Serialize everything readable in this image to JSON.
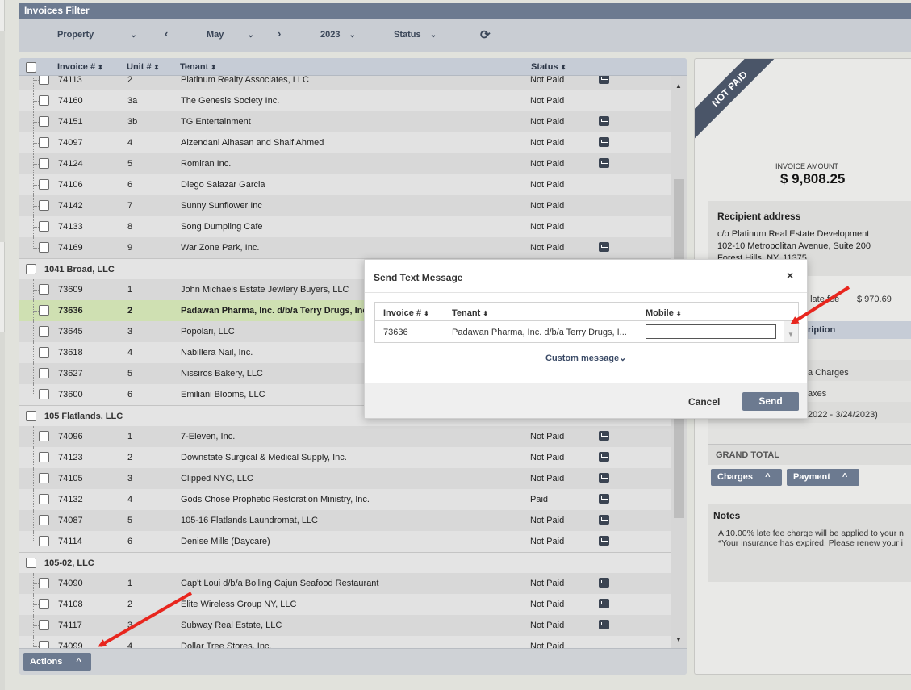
{
  "filter": {
    "title": "Invoices Filter",
    "property_label": "Property",
    "month": "May",
    "year": "2023",
    "status_label": "Status",
    "chev_down": "⌄",
    "prev_glyph": "‹",
    "next_glyph": "›",
    "refresh_glyph": "⟳"
  },
  "list": {
    "columns": {
      "invoice": "Invoice #",
      "unit": "Unit #",
      "tenant": "Tenant",
      "status": "Status"
    },
    "sort_glyph": "⬍",
    "rows": [
      {
        "type": "row",
        "invoice": "74113",
        "unit": "2",
        "tenant": "Platinum Realty Associates, LLC",
        "status": "Not Paid",
        "mail": true,
        "clip": true
      },
      {
        "type": "row",
        "invoice": "74160",
        "unit": "3a",
        "tenant": "The Genesis Society Inc.",
        "status": "Not Paid",
        "mail": false
      },
      {
        "type": "row",
        "invoice": "74151",
        "unit": "3b",
        "tenant": "TG Entertainment",
        "status": "Not Paid",
        "mail": true
      },
      {
        "type": "row",
        "invoice": "74097",
        "unit": "4",
        "tenant": "Alzendani Alhasan and Shaif Ahmed",
        "status": "Not Paid",
        "mail": true
      },
      {
        "type": "row",
        "invoice": "74124",
        "unit": "5",
        "tenant": "Romiran Inc.",
        "status": "Not Paid",
        "mail": true
      },
      {
        "type": "row",
        "invoice": "74106",
        "unit": "6",
        "tenant": "Diego Salazar Garcia",
        "status": "Not Paid",
        "mail": false
      },
      {
        "type": "row",
        "invoice": "74142",
        "unit": "7",
        "tenant": "Sunny Sunflower Inc",
        "status": "Not Paid",
        "mail": false
      },
      {
        "type": "row",
        "invoice": "74133",
        "unit": "8",
        "tenant": "Song Dumpling Cafe",
        "status": "Not Paid",
        "mail": false
      },
      {
        "type": "row",
        "invoice": "74169",
        "unit": "9",
        "tenant": "War Zone Park, Inc.",
        "status": "Not Paid",
        "mail": true,
        "last": true
      },
      {
        "type": "group",
        "name": "1041 Broad, LLC"
      },
      {
        "type": "row",
        "invoice": "73609",
        "unit": "1",
        "tenant": "John Michaels Estate Jewlery Buyers, LLC",
        "status": "",
        "mail": false
      },
      {
        "type": "row",
        "invoice": "73636",
        "unit": "2",
        "tenant": "Padawan Pharma, Inc. d/b/a Terry Drugs, Inc",
        "status": "",
        "mail": false,
        "selected": true
      },
      {
        "type": "row",
        "invoice": "73645",
        "unit": "3",
        "tenant": "Popolari, LLC",
        "status": "",
        "mail": false
      },
      {
        "type": "row",
        "invoice": "73618",
        "unit": "4",
        "tenant": "Nabillera Nail, Inc.",
        "status": "",
        "mail": false
      },
      {
        "type": "row",
        "invoice": "73627",
        "unit": "5",
        "tenant": "Nissiros Bakery, LLC",
        "status": "",
        "mail": false
      },
      {
        "type": "row",
        "invoice": "73600",
        "unit": "6",
        "tenant": "Emiliani Blooms, LLC",
        "status": "",
        "mail": false,
        "last": true
      },
      {
        "type": "group",
        "name": "105 Flatlands, LLC"
      },
      {
        "type": "row",
        "invoice": "74096",
        "unit": "1",
        "tenant": "7-Eleven, Inc.",
        "status": "Not Paid",
        "mail": true
      },
      {
        "type": "row",
        "invoice": "74123",
        "unit": "2",
        "tenant": "Downstate Surgical & Medical Supply, Inc.",
        "status": "Not Paid",
        "mail": true
      },
      {
        "type": "row",
        "invoice": "74105",
        "unit": "3",
        "tenant": "Clipped NYC, LLC",
        "status": "Not Paid",
        "mail": true
      },
      {
        "type": "row",
        "invoice": "74132",
        "unit": "4",
        "tenant": "Gods Chose Prophetic Restoration Ministry, Inc.",
        "status": "Paid",
        "mail": true
      },
      {
        "type": "row",
        "invoice": "74087",
        "unit": "5",
        "tenant": "105-16 Flatlands Laundromat, LLC",
        "status": "Not Paid",
        "mail": true
      },
      {
        "type": "row",
        "invoice": "74114",
        "unit": "6",
        "tenant": "Denise Mills (Daycare)",
        "status": "Not Paid",
        "mail": true,
        "last": true
      },
      {
        "type": "group",
        "name": "105-02, LLC"
      },
      {
        "type": "row",
        "invoice": "74090",
        "unit": "1",
        "tenant": "Cap't Loui d/b/a Boiling Cajun Seafood Restaurant",
        "status": "Not Paid",
        "mail": true
      },
      {
        "type": "row",
        "invoice": "74108",
        "unit": "2",
        "tenant": "Elite Wireless Group NY, LLC",
        "status": "Not Paid",
        "mail": true
      },
      {
        "type": "row",
        "invoice": "74117",
        "unit": "3",
        "tenant": "Subway Real Estate, LLC",
        "status": "Not Paid",
        "mail": true
      },
      {
        "type": "row",
        "invoice": "74099",
        "unit": "4",
        "tenant": "Dollar Tree Stores, Inc.",
        "status": "Not Paid",
        "mail": false
      }
    ],
    "actions_label": "Actions",
    "up_glyph": "^",
    "scroll_up": "▲",
    "scroll_down": "▼"
  },
  "invoice": {
    "ribbon": "NOT PAID",
    "amount_label": "INVOICE AMOUNT",
    "amount": "$ 9,808.25",
    "recipient_title": "Recipient address",
    "address_lines": [
      "c/o Platinum Real Estate Development",
      "102-10 Metropolitan Avenue, Suite 200",
      "Forest Hills, NY, 11375"
    ],
    "late_fee_label": "ply late fee",
    "late_fee_amount": "$ 970.69",
    "description_header": "ription",
    "desc_lines": [
      "a Charges",
      "axes",
      "2022 - 3/24/2023)"
    ],
    "grand_total_label": "GRAND TOTAL",
    "charges_label": "Charges",
    "payment_label": "Payment",
    "notes_title": "Notes",
    "notes_lines": [
      "A 10.00% late fee charge will be applied to your n",
      "*Your insurance has expired. Please renew your i"
    ]
  },
  "modal": {
    "title": "Send Text Message",
    "close_glyph": "×",
    "col_invoice": "Invoice #",
    "col_tenant": "Tenant",
    "col_mobile": "Mobile",
    "invoice": "73636",
    "tenant": "Padawan Pharma, Inc. d/b/a Terry Drugs, I...",
    "mobile_value": "",
    "custom_message_label": "Custom message",
    "custom_chev": "⌄",
    "cancel_label": "Cancel",
    "send_label": "Send"
  },
  "colors": {
    "header": "#6c7a90",
    "selected_row": "#cfe0b2",
    "annotation_arrow": "#e8261e"
  }
}
